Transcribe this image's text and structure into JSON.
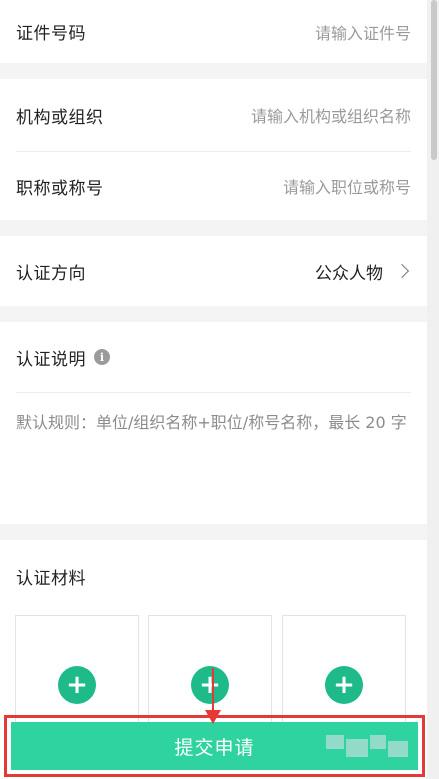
{
  "form": {
    "id_number": {
      "label": "证件号码",
      "placeholder": "请输入证件号"
    },
    "organization": {
      "label": "机构或组织",
      "placeholder": "请输入机构或组织名称"
    },
    "title": {
      "label": "职称或称号",
      "placeholder": "请输入职位或称号"
    },
    "direction": {
      "label": "认证方向",
      "value": "公众人物"
    },
    "explanation": {
      "label": "认证说明",
      "info_icon_glyph": "i",
      "text": "默认规则：单位/组织名称+职位/称号名称，最长 20 字"
    },
    "materials": {
      "label": "认证材料",
      "add_glyph": "+"
    }
  },
  "submit": {
    "label": "提交申请"
  },
  "colors": {
    "accent": "#2fd3a0",
    "plus": "#1fba8a",
    "highlight": "#e53935"
  }
}
